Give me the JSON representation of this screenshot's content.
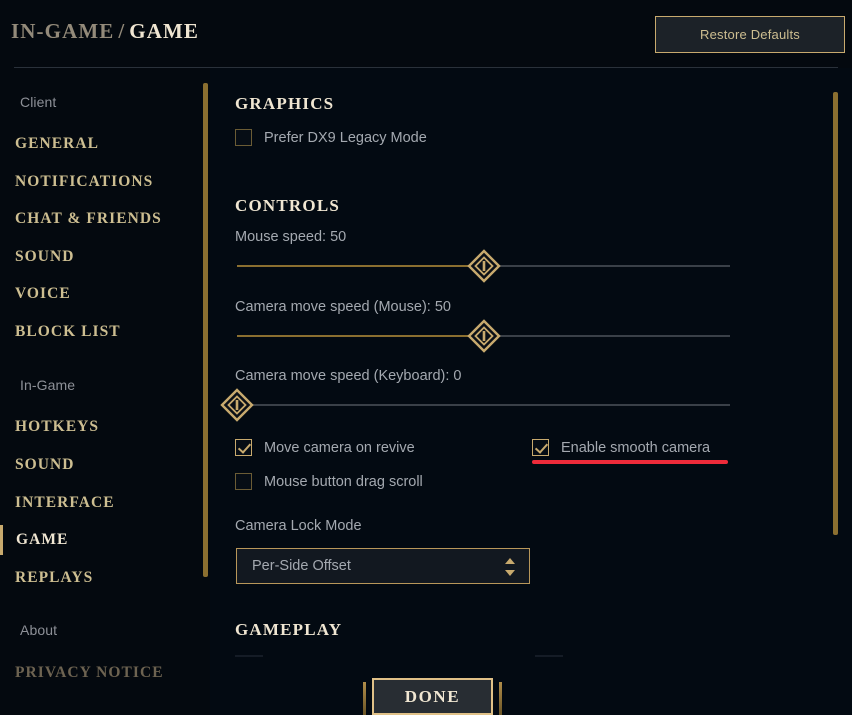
{
  "header": {
    "breadcrumb_parent": "IN-GAME",
    "breadcrumb_separator": "/",
    "breadcrumb_current": "GAME",
    "restore_label": "Restore Defaults"
  },
  "sidebar": {
    "groups": [
      {
        "label": "Client",
        "items": [
          {
            "label": "GENERAL"
          },
          {
            "label": "NOTIFICATIONS"
          },
          {
            "label": "CHAT & FRIENDS"
          },
          {
            "label": "SOUND"
          },
          {
            "label": "VOICE"
          },
          {
            "label": "BLOCK LIST"
          }
        ]
      },
      {
        "label": "In-Game",
        "items": [
          {
            "label": "HOTKEYS"
          },
          {
            "label": "SOUND"
          },
          {
            "label": "INTERFACE"
          },
          {
            "label": "GAME"
          },
          {
            "label": "REPLAYS"
          }
        ]
      },
      {
        "label": "About",
        "items": [
          {
            "label": "PRIVACY NOTICE"
          }
        ]
      }
    ],
    "selected": "GAME"
  },
  "main": {
    "sections": {
      "graphics": {
        "title": "GRAPHICS",
        "prefer_dx9": {
          "label": "Prefer DX9 Legacy Mode",
          "checked": false
        }
      },
      "controls": {
        "title": "CONTROLS",
        "sliders": [
          {
            "label": "Mouse speed: 50",
            "name": "Mouse speed",
            "value": 50,
            "min": 0,
            "max": 100,
            "percent": 50
          },
          {
            "label": "Camera move speed (Mouse): 50",
            "name": "Camera move speed (Mouse)",
            "value": 50,
            "min": 0,
            "max": 100,
            "percent": 50
          },
          {
            "label": "Camera move speed (Keyboard): 0",
            "name": "Camera move speed (Keyboard)",
            "value": 0,
            "min": 0,
            "max": 100,
            "percent": 0
          }
        ],
        "checkboxes": [
          {
            "label": "Move camera on revive",
            "checked": true
          },
          {
            "label": "Enable smooth camera",
            "checked": true
          },
          {
            "label": "Mouse button drag scroll",
            "checked": false
          }
        ],
        "camera_lock": {
          "label": "Camera Lock Mode",
          "value": "Per-Side Offset"
        }
      },
      "gameplay": {
        "title": "GAMEPLAY"
      }
    }
  },
  "footer": {
    "done_label": "DONE"
  },
  "colors": {
    "background": "#030a12",
    "panel": "#04090f",
    "gold": "#c8aa6e",
    "gold_dim": "#8b6f30",
    "text_gold": "#cdbe91",
    "text_bright": "#f0e6d2",
    "text_grey": "#a4a9b0",
    "annotation_red": "#ee2b3a"
  }
}
